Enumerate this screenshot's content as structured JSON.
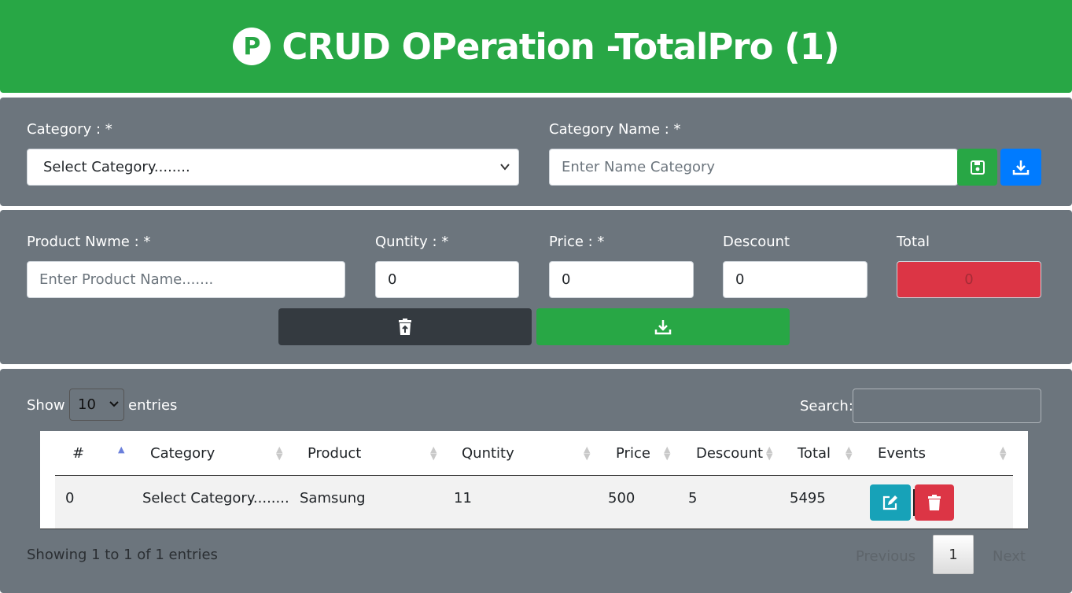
{
  "header": {
    "logo_letter": "P",
    "title": "CRUD OPeration -TotalPro (1)"
  },
  "category_form": {
    "category_label": "Category : *",
    "category_select_value": "Select Category........",
    "category_name_label": "Category Name : *",
    "category_name_placeholder": "Enter Name Category"
  },
  "product_form": {
    "product_name_label": "Product Nwme : *",
    "product_name_placeholder": "Enter Product Name.......",
    "quantity_label": "Quntity : *",
    "quantity_value": "0",
    "price_label": "Price : *",
    "price_value": "0",
    "discount_label": "Descount",
    "discount_value": "0",
    "total_label": "Total",
    "total_value": "0"
  },
  "table_controls": {
    "show_label": "Show",
    "entries_value": "10",
    "entries_label": "entries",
    "search_label": "Search:"
  },
  "table": {
    "columns": [
      "#",
      "Category",
      "Product",
      "Quntity",
      "Price",
      "Descount",
      "Total",
      "Events"
    ],
    "rows": [
      {
        "id": "0",
        "category": "Select Category........",
        "product": "Samsung",
        "quantity": "11",
        "price": "500",
        "discount": "5",
        "total": "5495"
      }
    ]
  },
  "footer": {
    "info": "Showing 1 to 1 of 1 entries",
    "previous": "Previous",
    "current_page": "1",
    "next": "Next"
  },
  "colors": {
    "green": "#28a745",
    "gray_panel": "#6c757d",
    "blue": "#007bff",
    "red": "#dc3545",
    "dark": "#343a40",
    "info": "#17a2b8"
  }
}
